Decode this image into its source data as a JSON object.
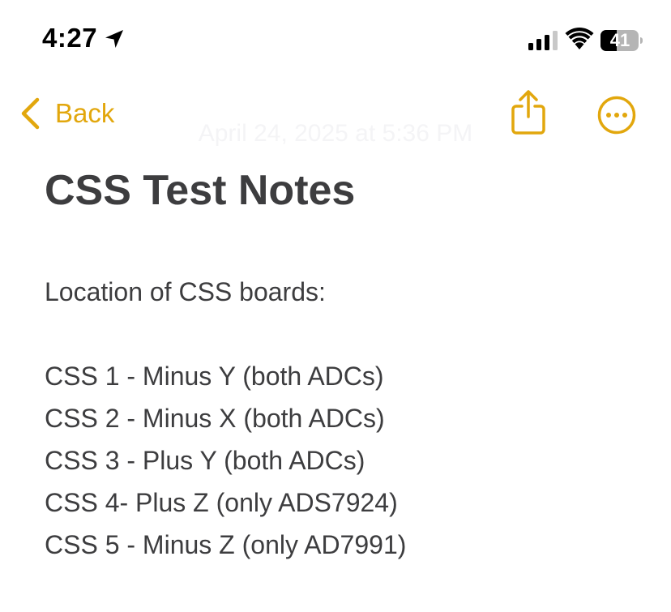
{
  "status_bar": {
    "time": "4:27",
    "battery": "41",
    "icons": [
      "location-arrow-icon",
      "cellular-signal-icon",
      "wifi-icon",
      "battery-icon"
    ]
  },
  "nav": {
    "back_label": "Back",
    "date": "April 24, 2025 at 5:36 PM",
    "share_icon": "share-icon",
    "more_icon": "more-ellipsis-icon"
  },
  "note": {
    "title": "CSS Test Notes",
    "heading_line": "Location of CSS boards:",
    "lines": [
      "CSS 1 - Minus Y (both ADCs)",
      "CSS 2 - Minus X (both ADCs)",
      "CSS 3 - Plus Y (both ADCs)",
      "CSS 4- Plus Z (only ADS7924)",
      "CSS 5 - Minus Z (only AD7991)"
    ]
  },
  "colors": {
    "accent": "#e2a70d",
    "text": "#3d3d3f",
    "background": "#ffffff"
  }
}
